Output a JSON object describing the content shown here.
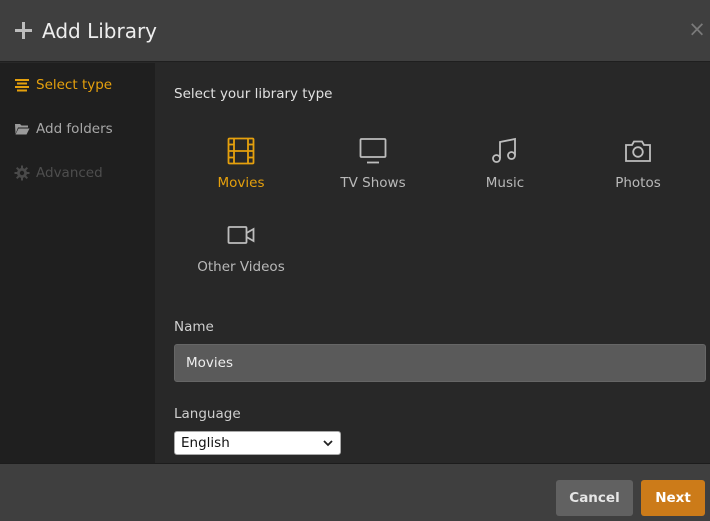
{
  "header": {
    "title": "Add Library",
    "close_glyph": "×"
  },
  "sidebar": {
    "items": [
      {
        "label": "Select type",
        "icon": "list-align-icon",
        "state": "active"
      },
      {
        "label": "Add folders",
        "icon": "folder-icon",
        "state": "normal"
      },
      {
        "label": "Advanced",
        "icon": "gear-icon",
        "state": "disabled"
      }
    ]
  },
  "main": {
    "prompt": "Select your library type",
    "types": [
      {
        "label": "Movies",
        "icon": "film-icon",
        "selected": true
      },
      {
        "label": "TV Shows",
        "icon": "tv-icon",
        "selected": false
      },
      {
        "label": "Music",
        "icon": "music-note-icon",
        "selected": false
      },
      {
        "label": "Photos",
        "icon": "camera-icon",
        "selected": false
      },
      {
        "label": "Other Videos",
        "icon": "video-camera-icon",
        "selected": false
      }
    ],
    "name_label": "Name",
    "name_value": "Movies",
    "language_label": "Language",
    "language_value": "English"
  },
  "footer": {
    "cancel_label": "Cancel",
    "next_label": "Next"
  },
  "colors": {
    "accent": "#e5a00d",
    "next_button": "#cc7b19",
    "sidebar_bg": "#1f1f1f",
    "header_bg": "#3f3f3f"
  }
}
